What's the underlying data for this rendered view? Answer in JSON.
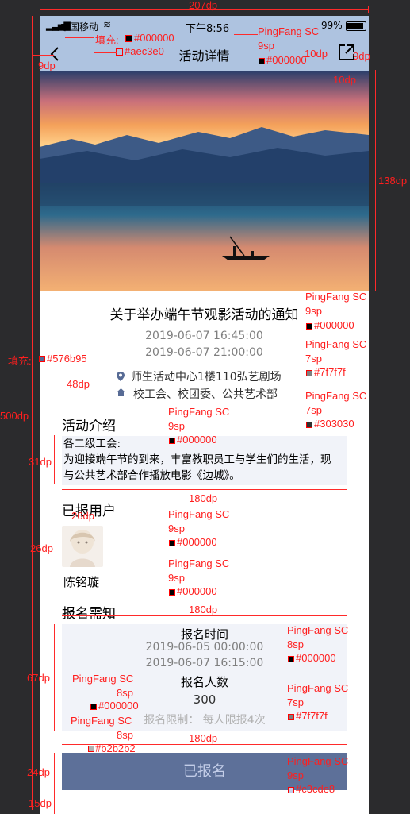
{
  "canvas_dims": {
    "top_width": "207dp",
    "height_total": "500dp"
  },
  "status_bar": {
    "carrier": "中国移动",
    "time": "下午8:56",
    "battery": "99%"
  },
  "nav": {
    "title": "活动详情"
  },
  "event": {
    "title": "关于举办端午节观影活动的通知",
    "start_time": "2019-06-07 16:45:00",
    "end_time": "2019-06-07 21:00:00",
    "location": "师生活动中心1楼110弘艺剧场",
    "organizer": "校工会、校团委、公共艺术部"
  },
  "intro": {
    "heading": "活动介绍",
    "line1": "各二级工会:",
    "line2": "为迎接端午节的到来，丰富教职员工与学生们的生活，现",
    "line3": "与公共艺术部合作播放电影《边城》。"
  },
  "registered": {
    "heading": "已报用户",
    "user_name": "陈铭璇"
  },
  "notice": {
    "heading": "报名需知",
    "time_label": "报名时间",
    "time_start": "2019-06-05 00:00:00",
    "time_end": "2019-06-07 16:15:00",
    "count_label": "报名人数",
    "count_value": "300",
    "limit_text": "报名限制：  每人限报4次"
  },
  "button": {
    "label": "已报名"
  },
  "annotations": {
    "fill_label": "填充:",
    "color_000": "#000000",
    "color_aec3e0": "#aec3e0",
    "nav_font": "PingFang SC",
    "nav_size": "9sp",
    "nav_color": "#000000",
    "back_pad": "9dp",
    "icon_size_a": "10dp",
    "icon_size_b": "9dp",
    "icon_size_c": "10dp",
    "image_h": "138dp",
    "title_font": "PingFang SC",
    "title_size": "9sp",
    "title_color": "#000000",
    "time_font": "PingFang SC",
    "time_size": "7sp",
    "time_color": "#7f7f7f",
    "icon_fill_label": "填充:",
    "icon_color": "#576b95",
    "loc_indent": "48dp",
    "loc_font": "PingFang SC",
    "loc_size": "7sp",
    "loc_color": "#303030",
    "h_500": "500dp",
    "sec_font": "PingFang SC",
    "sec_size": "9sp",
    "sec_color": "#000000",
    "intro_h": "31dp",
    "intro_w": "180dp",
    "avatar_w": "26dp",
    "reg_font": "PingFang SC",
    "reg_size": "9sp",
    "reg_color": "#000000",
    "avatar_h": "26dp",
    "name_font": "PingFang SC",
    "name_size": "9sp",
    "name_color": "#000000",
    "notice_w": "180dp",
    "nt_font": "PingFang SC",
    "nt_size": "8sp",
    "nt_color": "#000000",
    "notice_h": "67dp",
    "ntime_font": "PingFang SC",
    "ntime_size": "7sp",
    "ntime_color": "#7f7f7f",
    "nc_font": "PingFang SC",
    "nc_size": "8sp",
    "nc_color": "#000000",
    "lim_font": "PingFang SC",
    "lim_size": "8sp",
    "lim_color": "#b2b2b2",
    "box_w": "180dp",
    "btn_h": "24dp",
    "btn_font": "PingFang SC",
    "btn_size": "9sp",
    "btn_color": "#c3cde8",
    "bottom_gap": "15dp"
  }
}
